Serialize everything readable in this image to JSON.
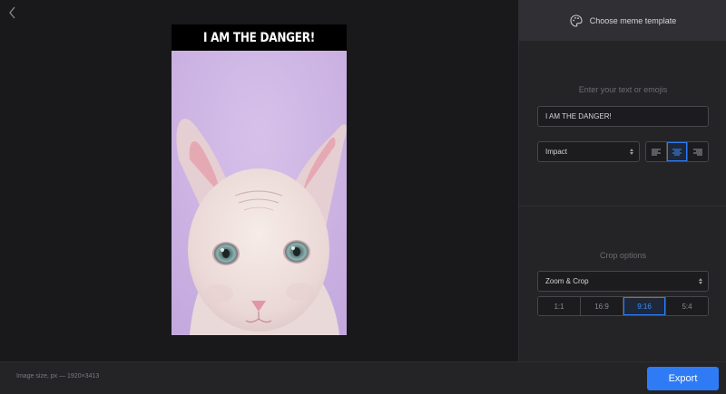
{
  "canvas": {
    "meme_text": "I AM THE DANGER!"
  },
  "panel": {
    "template_button_label": "Choose meme template",
    "text_section_label": "Enter your text or emojis",
    "text_input_value": "I AM THE DANGER!",
    "font_select_value": "Impact",
    "alignment_options": [
      "left",
      "center",
      "right"
    ],
    "alignment_selected": "center",
    "crop_section_label": "Crop options",
    "crop_select_value": "Zoom & Crop",
    "ratios": [
      "1:1",
      "16:9",
      "9:16",
      "5:4"
    ],
    "ratio_selected": "9:16"
  },
  "footer": {
    "image_size_text": "Image size, px — 1920×3413",
    "export_label": "Export"
  },
  "colors": {
    "accent": "#2f7bf5",
    "background": "#1c1c1f",
    "panel": "#242427"
  },
  "icons": {
    "back": "chevron-left-icon",
    "template": "palette-icon"
  }
}
